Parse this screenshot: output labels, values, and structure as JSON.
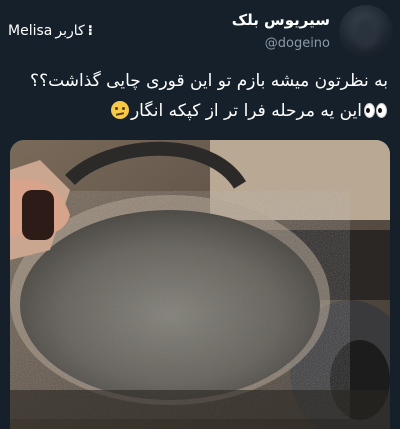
{
  "tweet": {
    "author": {
      "display_name": "سیریوس بلک",
      "handle": "@dogeino",
      "avatar_icon": "profile-avatar"
    },
    "text_lines": [
      "به نظرتون میشه بازم تو این قوری چایی گذاشت؟؟",
      "این یه مرحله فرا تر از کپکه انگار"
    ],
    "emojis": [
      "eyes-emoji",
      "confused-face-emoji"
    ]
  },
  "watermark": {
    "name": "Melisa",
    "label": "کاربر",
    "icon": "kebab-dots-icon"
  },
  "media": {
    "alt_icon": "moldy-teapot-photo"
  }
}
